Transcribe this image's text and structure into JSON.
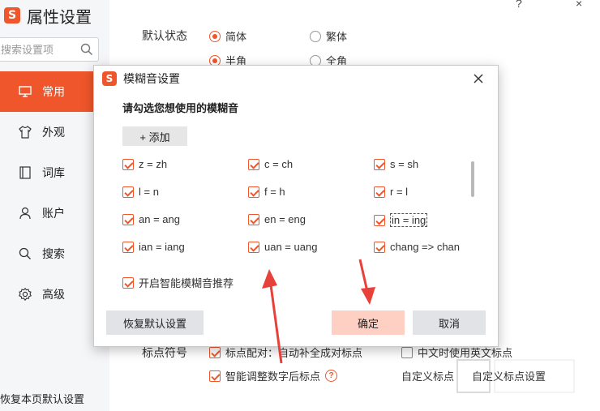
{
  "app": {
    "logo_letter": "S",
    "title": "属性设置",
    "help_glyph": "?",
    "close_glyph": "×"
  },
  "sidebar": {
    "search_placeholder": "搜索设置项",
    "items": [
      {
        "label": "常用",
        "icon": "monitor-icon",
        "active": true
      },
      {
        "label": "外观",
        "icon": "shirt-icon",
        "active": false
      },
      {
        "label": "词库",
        "icon": "book-icon",
        "active": false
      },
      {
        "label": "账户",
        "icon": "user-icon",
        "active": false
      },
      {
        "label": "搜索",
        "icon": "search-icon",
        "active": false
      },
      {
        "label": "高级",
        "icon": "gear-icon",
        "active": false
      }
    ],
    "restore_page_label": "恢复本页默认设置"
  },
  "main": {
    "default_state_label": "默认状态",
    "radio_simplified": "简体",
    "radio_traditional": "繁体",
    "radio_halfwidth": "半角",
    "radio_fullwidth": "全角",
    "punct_label": "标点符号",
    "punct_pair": "标点配对：自动补全成对标点",
    "punct_english": "中文时使用英文标点",
    "smart_number": "智能调整数字后标点",
    "custom_punct": "自定义标点",
    "custom_punct_settings": "自定义标点设置"
  },
  "dialog": {
    "logo_letter": "S",
    "title": "模糊音设置",
    "heading": "请勾选您想使用的模糊音",
    "add_button": "+ 添加",
    "fuzzy": [
      {
        "label": "z = zh",
        "checked": true
      },
      {
        "label": "c = ch",
        "checked": true
      },
      {
        "label": "s = sh",
        "checked": true
      },
      {
        "label": "l = n",
        "checked": true
      },
      {
        "label": "f = h",
        "checked": true
      },
      {
        "label": "r = l",
        "checked": true
      },
      {
        "label": "an = ang",
        "checked": true
      },
      {
        "label": "en = eng",
        "checked": true
      },
      {
        "label": "in = ing",
        "checked": true
      },
      {
        "label": "ian = iang",
        "checked": true
      },
      {
        "label": "uan = uang",
        "checked": true
      },
      {
        "label": "chang => chan",
        "checked": true
      }
    ],
    "smart_fuzzy": "开启智能模糊音推荐",
    "reset_button": "恢复默认设置",
    "ok_button": "确定",
    "cancel_button": "取消"
  },
  "colors": {
    "accent": "#f0562b",
    "sidebar_bg": "#f5f6f8",
    "ok_button_bg": "#fdd0c3",
    "arrow_red": "#e8413a"
  }
}
